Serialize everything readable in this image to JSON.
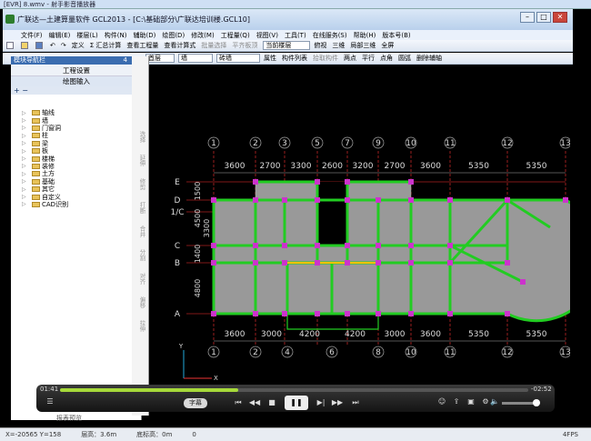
{
  "player": {
    "title": "[EVR] 8.wmv - 射手影音播放器",
    "time_elapsed": "01:41",
    "time_remaining": "-02:52",
    "progress": 0.38,
    "volume": 0.85,
    "subtitle_label": "字幕",
    "controls": {
      "prev": "⏮",
      "rewind": "◀◀",
      "stop": "■",
      "play_pause": "❚❚",
      "next": "▶|",
      "forward": "▶▶",
      "last": "⏭"
    },
    "report_preview_label": "报表预览"
  },
  "app": {
    "title": "广联达—土建算量软件 GCL2013 - [C:\\基础部分\\广联达培训楼.GCL10]",
    "window_buttons": {
      "min": "–",
      "max": "□",
      "close": "✕"
    }
  },
  "menu": [
    "文件(F)",
    "编辑(E)",
    "楼层(L)",
    "构件(N)",
    "辅助(D)",
    "绘图(D)",
    "修改(M)",
    "工程量(Q)",
    "视图(V)",
    "工具(T)",
    "在线服务(S)",
    "帮助(H)",
    "版本号(B)"
  ],
  "toolbar1": {
    "items": [
      "定义",
      "Σ 汇总计算",
      "查看工程量",
      "查看计算式",
      "批量选择",
      "平齐板顶"
    ],
    "floor_select": "当前楼层",
    "right_items": [
      "俯视",
      "三维",
      "局部三维",
      "全屏"
    ]
  },
  "toolbar2": {
    "floor": "首层",
    "category": "墙",
    "component": "砖墙",
    "items": [
      "属性",
      "构件列表",
      "拾取构件",
      "两点",
      "平行",
      "点角",
      "圆弧",
      "删除辅轴"
    ]
  },
  "left_panel": {
    "header": "模块导航栏",
    "pin": "4",
    "close": "×",
    "btn_project_settings": "工程设置",
    "btn_drawing_input": "绘图输入",
    "tree_tools": "+ −",
    "tree": [
      "轴线",
      "墙",
      "门窗洞",
      "柱",
      "梁",
      "板",
      "楼梯",
      "装修",
      "土方",
      "基础",
      "其它",
      "自定义",
      "CAD识别"
    ]
  },
  "left_tools": [
    "选择",
    "延伸",
    "修剪",
    "打断",
    "合并",
    "分割",
    "对齐",
    "偏移",
    "拉伸"
  ],
  "status": {
    "coords": "X=-20565 Y=158",
    "floor_height": "层高：3.6m",
    "bottom_elev": "底标高：0m",
    "zero": "0",
    "fps": "4FPS"
  },
  "drawing": {
    "top_axes": [
      "1",
      "2",
      "3",
      "5",
      "7",
      "9",
      "10",
      "11",
      "12",
      "13"
    ],
    "top_dims": [
      "3600",
      "2700",
      "3300",
      "2600",
      "3200",
      "2700",
      "3600",
      "5350",
      "5350"
    ],
    "bottom_axes": [
      "1",
      "2",
      "4",
      "6",
      "8",
      "10",
      "11",
      "12",
      "13"
    ],
    "bottom_dims": [
      "3600",
      "3000",
      "4200",
      "4200",
      "3000",
      "3600",
      "5350",
      "5350"
    ],
    "left_axes": [
      "E",
      "D",
      "1/C",
      "C",
      "B",
      "A"
    ],
    "left_dims": [
      "1500",
      "4500",
      "3300",
      "1400",
      "4800"
    ],
    "axis_x_label": "X",
    "axis_y_label": "Y",
    "colors": {
      "wall": "#22cc22",
      "slab": "#999999",
      "grid": "#ff3333",
      "node": "#cc33cc",
      "beam": "#f2c200"
    }
  }
}
